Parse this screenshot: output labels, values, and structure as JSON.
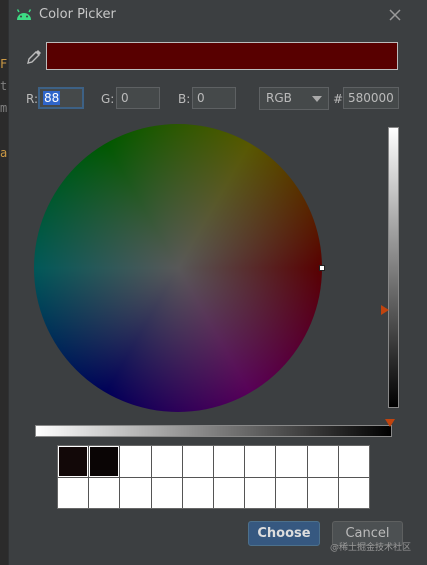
{
  "background_fragments": [
    "F",
    "t",
    "m",
    "a"
  ],
  "dialog": {
    "title": "Color Picker",
    "close_icon": "close-icon",
    "app_icon": "android-icon"
  },
  "preview": {
    "color": "#580000"
  },
  "fields": {
    "r_label": "R:",
    "r_value": "88",
    "g_label": "G:",
    "g_value": "0",
    "b_label": "B:",
    "b_value": "0",
    "mode_value": "RGB",
    "hash_label": "#",
    "hex_value": "580000"
  },
  "recent_colors": {
    "filled": [
      "#120808",
      "#0a0505"
    ],
    "empty_count": 18
  },
  "buttons": {
    "choose": "Choose",
    "cancel": "Cancel"
  },
  "watermark": "@稀土掘金技术社区",
  "colors": {
    "accent": "#365880",
    "slider_thumb": "#c1440e",
    "focus_border": "#3d6185"
  }
}
